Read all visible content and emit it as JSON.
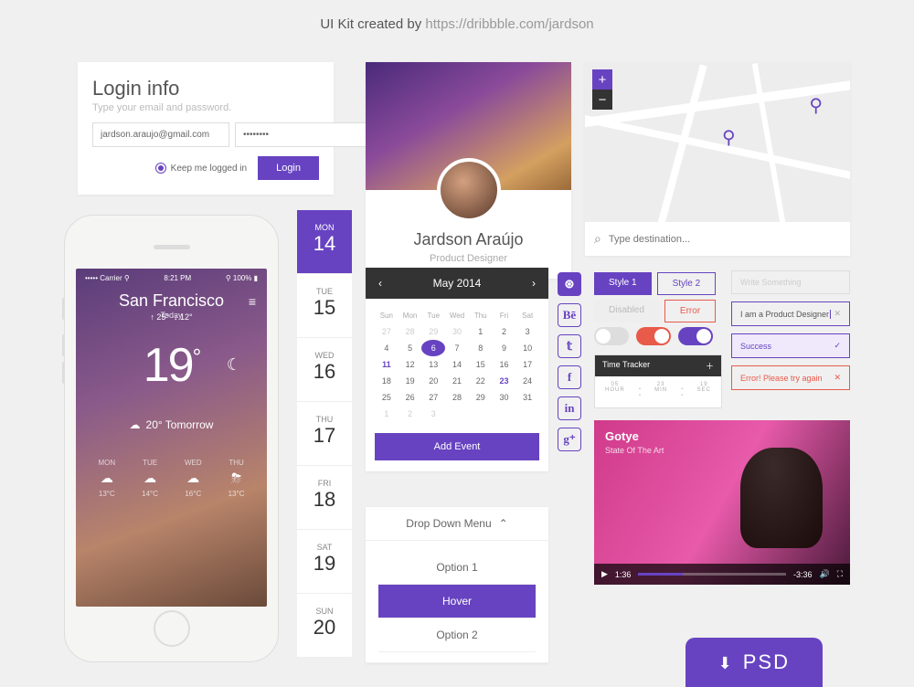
{
  "credit": {
    "prefix": "UI Kit created by ",
    "link": "https://dribbble.com/jardson"
  },
  "login": {
    "title": "Login info",
    "subtitle": "Type your email and password.",
    "email": "jardson.araujo@gmail.com",
    "password": "••••••••",
    "keep": "Keep me logged in",
    "button": "Login"
  },
  "weather": {
    "carrier": "••••• Carrier ⚲",
    "time": "8:21 PM",
    "batt": "⚲ 100% ▮",
    "city": "San Francisco",
    "today": "Today",
    "temp": "19",
    "high": "↑ 25°",
    "low": "↓ 12°",
    "tomorrow": "20° Tomorrow",
    "days": [
      {
        "d": "MON",
        "ic": "☁",
        "t": "13°C"
      },
      {
        "d": "TUE",
        "ic": "☁",
        "t": "14°C"
      },
      {
        "d": "WED",
        "ic": "☁",
        "t": "16°C"
      },
      {
        "d": "THU",
        "ic": "⛈",
        "t": "13°C"
      }
    ]
  },
  "daystrip": [
    {
      "dow": "MON",
      "num": "14",
      "active": true
    },
    {
      "dow": "TUE",
      "num": "15"
    },
    {
      "dow": "WED",
      "num": "16"
    },
    {
      "dow": "THU",
      "num": "17"
    },
    {
      "dow": "FRI",
      "num": "18"
    },
    {
      "dow": "SAT",
      "num": "19"
    },
    {
      "dow": "SUN",
      "num": "20"
    }
  ],
  "profile": {
    "name": "Jardson Araújo",
    "role": "Product Designer"
  },
  "calendar": {
    "month": "May 2014",
    "dow": [
      "Sun",
      "Mon",
      "Tue",
      "Wed",
      "Thu",
      "Fri",
      "Sat"
    ],
    "weeks": [
      [
        "27",
        "28",
        "29",
        "30",
        "1",
        "2",
        "3"
      ],
      [
        "4",
        "5",
        "6",
        "7",
        "8",
        "9",
        "10"
      ],
      [
        "11",
        "12",
        "13",
        "14",
        "15",
        "16",
        "17"
      ],
      [
        "18",
        "19",
        "20",
        "21",
        "22",
        "23",
        "24"
      ],
      [
        "25",
        "26",
        "27",
        "28",
        "29",
        "30",
        "31"
      ],
      [
        "1",
        "2",
        "3",
        "",
        "",
        "",
        ""
      ]
    ],
    "selected": "6",
    "highlight": [
      "11",
      "23"
    ],
    "dim_before": 4,
    "dim_last_row": true,
    "add": "Add Event"
  },
  "dropdown": {
    "title": "Drop Down Menu",
    "items": [
      "Option 1",
      "Hover",
      "Option 2"
    ],
    "hover_index": 1
  },
  "map": {
    "placeholder": "Type destination..."
  },
  "buttons": {
    "b1": "Style 1",
    "b2": "Style 2",
    "b3": "Disabled",
    "b4": "Error"
  },
  "timer": {
    "title": "Time Tracker",
    "h": "05",
    "m": "23",
    "s": "19",
    "hl": "HOUR",
    "ml": "MIN",
    "sl": "SEC"
  },
  "inputs": {
    "placeholder": "Write Something",
    "filled": "I am a Product Designer",
    "success": "Success",
    "error": "Error! Please try again"
  },
  "video": {
    "title": "Gotye",
    "subtitle": "State Of The Art",
    "elapsed": "1:36",
    "remain": "-3:36"
  },
  "psd": "PSD",
  "colors": {
    "accent": "#6743c1",
    "error": "#e85a4a"
  }
}
